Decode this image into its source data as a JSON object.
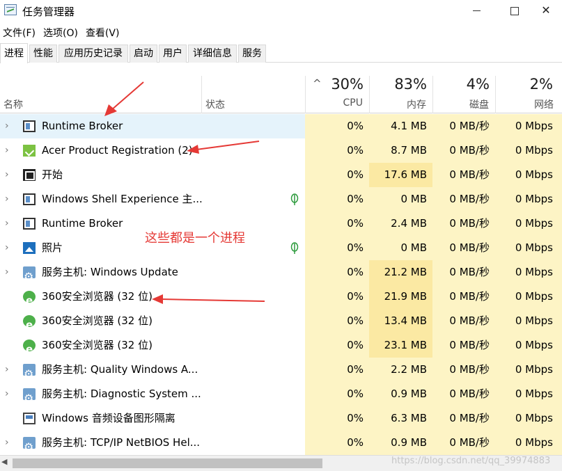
{
  "window": {
    "title": "任务管理器",
    "icon": "task-manager-icon"
  },
  "menu": [
    "文件(F)",
    "选项(O)",
    "查看(V)"
  ],
  "tabs": [
    "进程",
    "性能",
    "应用历史记录",
    "启动",
    "用户",
    "详细信息",
    "服务"
  ],
  "active_tab": "进程",
  "columns": {
    "name": "名称",
    "status": "状态",
    "cpu": {
      "label": "CPU",
      "percent": "30%"
    },
    "memory": {
      "label": "内存",
      "percent": "83%"
    },
    "disk": {
      "label": "磁盘",
      "percent": "4%"
    },
    "network": {
      "label": "网络",
      "percent": "2%"
    }
  },
  "processes": [
    {
      "name": "Runtime Broker",
      "icon": "window-icon",
      "expandable": true,
      "status_leaf": false,
      "cpu": "0%",
      "memory": "4.1 MB",
      "disk": "0 MB/秒",
      "network": "0 Mbps",
      "selected": true
    },
    {
      "name": "Acer Product Registration (2)",
      "icon": "acer-icon",
      "expandable": true,
      "status_leaf": false,
      "cpu": "0%",
      "memory": "8.7 MB",
      "disk": "0 MB/秒",
      "network": "0 Mbps"
    },
    {
      "name": "开始",
      "icon": "start-icon",
      "expandable": true,
      "status_leaf": false,
      "cpu": "0%",
      "memory": "17.6 MB",
      "disk": "0 MB/秒",
      "network": "0 Mbps"
    },
    {
      "name": "Windows Shell Experience 主...",
      "icon": "window-icon",
      "expandable": true,
      "status_leaf": true,
      "cpu": "0%",
      "memory": "0 MB",
      "disk": "0 MB/秒",
      "network": "0 Mbps"
    },
    {
      "name": "Runtime Broker",
      "icon": "window-icon",
      "expandable": true,
      "status_leaf": false,
      "cpu": "0%",
      "memory": "2.4 MB",
      "disk": "0 MB/秒",
      "network": "0 Mbps"
    },
    {
      "name": "照片",
      "icon": "photos-icon",
      "expandable": true,
      "status_leaf": true,
      "cpu": "0%",
      "memory": "0 MB",
      "disk": "0 MB/秒",
      "network": "0 Mbps"
    },
    {
      "name": "服务主机: Windows Update",
      "icon": "gear-icon",
      "expandable": true,
      "status_leaf": false,
      "cpu": "0%",
      "memory": "21.2 MB",
      "disk": "0 MB/秒",
      "network": "0 Mbps"
    },
    {
      "name": "360安全浏览器 (32 位)",
      "icon": "browser-icon",
      "expandable": false,
      "status_leaf": false,
      "cpu": "0%",
      "memory": "21.9 MB",
      "disk": "0 MB/秒",
      "network": "0 Mbps"
    },
    {
      "name": "360安全浏览器 (32 位)",
      "icon": "browser-icon",
      "expandable": false,
      "status_leaf": false,
      "cpu": "0%",
      "memory": "13.4 MB",
      "disk": "0 MB/秒",
      "network": "0 Mbps"
    },
    {
      "name": "360安全浏览器 (32 位)",
      "icon": "browser-icon",
      "expandable": false,
      "status_leaf": false,
      "cpu": "0%",
      "memory": "23.1 MB",
      "disk": "0 MB/秒",
      "network": "0 Mbps"
    },
    {
      "name": "服务主机: Quality Windows A...",
      "icon": "gear-icon",
      "expandable": true,
      "status_leaf": false,
      "cpu": "0%",
      "memory": "2.2 MB",
      "disk": "0 MB/秒",
      "network": "0 Mbps"
    },
    {
      "name": "服务主机: Diagnostic System ...",
      "icon": "gear-icon",
      "expandable": true,
      "status_leaf": false,
      "cpu": "0%",
      "memory": "0.9 MB",
      "disk": "0 MB/秒",
      "network": "0 Mbps"
    },
    {
      "name": "Windows 音频设备图形隔离",
      "icon": "audio-icon",
      "expandable": false,
      "status_leaf": false,
      "cpu": "0%",
      "memory": "6.3 MB",
      "disk": "0 MB/秒",
      "network": "0 Mbps"
    },
    {
      "name": "服务主机: TCP/IP NetBIOS Hel...",
      "icon": "gear-icon",
      "expandable": true,
      "status_leaf": false,
      "cpu": "0%",
      "memory": "0.9 MB",
      "disk": "0 MB/秒",
      "network": "0 Mbps"
    }
  ],
  "annotation": "这些都是一个进程",
  "watermark": "https://blog.csdn.net/qq_39974883",
  "colors": {
    "usage_light": "#fdf4c5",
    "usage_medium": "#fbe9a3",
    "selection": "#e5f3fb",
    "annotation_red": "#e53935"
  }
}
